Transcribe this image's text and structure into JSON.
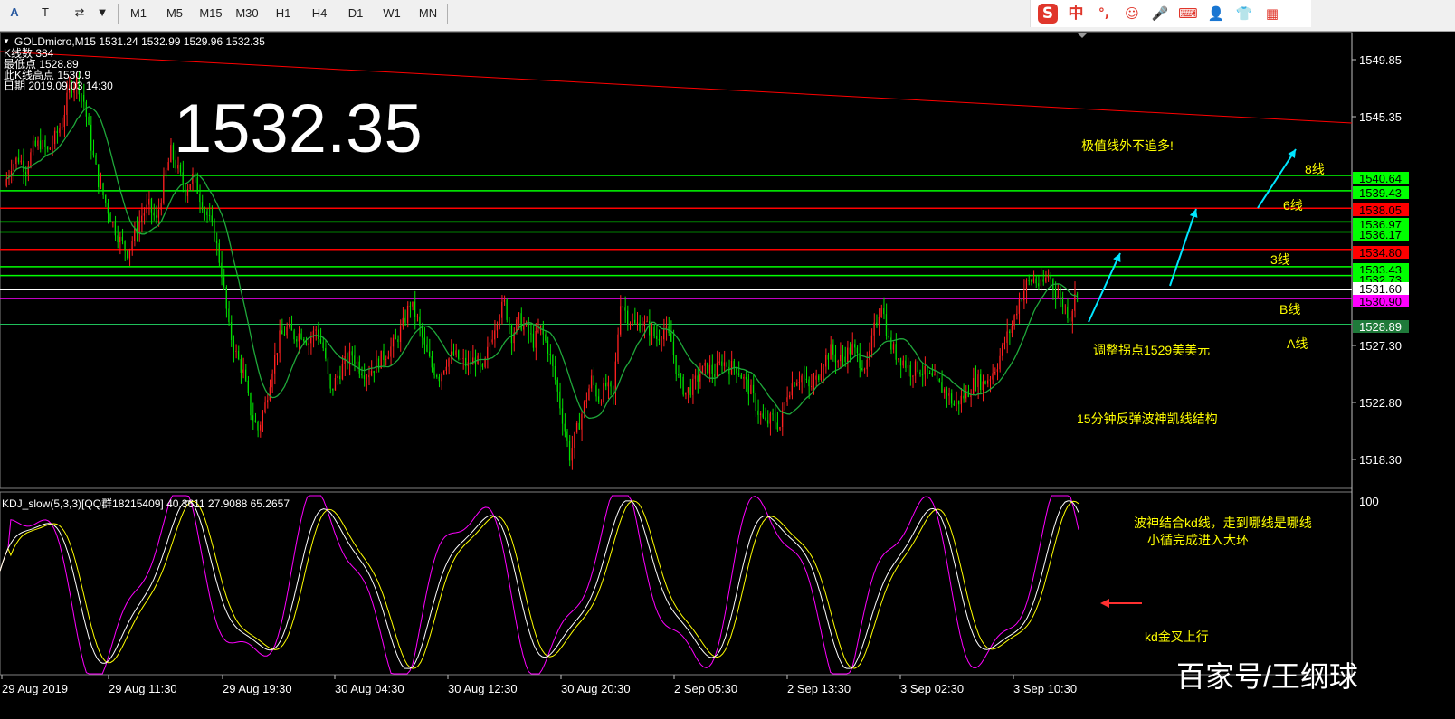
{
  "toolbar": {
    "left_tools": [
      {
        "name": "text-tool",
        "label": "A"
      },
      {
        "name": "text-label-tool",
        "label": "T"
      },
      {
        "name": "arrows-tool",
        "label": "⇄"
      },
      {
        "name": "dropdown",
        "label": "▼"
      }
    ],
    "timeframes": [
      "M1",
      "M5",
      "M15",
      "M30",
      "H1",
      "H4",
      "D1",
      "W1",
      "MN"
    ],
    "ime_bar": {
      "logo": "S",
      "mode": "中",
      "punct": "°,",
      "icons": [
        "emoji-icon",
        "microphone-icon",
        "keyboard-icon",
        "user-icon",
        "shirt-icon",
        "grid-icon"
      ]
    }
  },
  "main_chart": {
    "header": "GOLDmicro,M15  1531.24 1532.99 1529.96 1532.35",
    "info_lines": [
      "K线数  384",
      "最低点 1528.89",
      "此K线高点 1530.9",
      "日期 2019.09.03 14:30"
    ],
    "big_price": "1532.35",
    "annotations": [
      {
        "text": "极值线外不追多!",
        "color": "#ffff00"
      },
      {
        "text": "8线",
        "color": "#ffff00"
      },
      {
        "text": "6线",
        "color": "#ffff00"
      },
      {
        "text": "3线",
        "color": "#ffff00"
      },
      {
        "text": "B线",
        "color": "#ffff00"
      },
      {
        "text": "A线",
        "color": "#ffff00"
      },
      {
        "text": "调整拐点1529美美元",
        "color": "#ffff00"
      },
      {
        "text": "15分钟反弹波神凯线结构",
        "color": "#ffff00"
      }
    ],
    "price_axis": [
      "1549.85",
      "1545.35",
      "1527.30",
      "1522.80",
      "1518.30"
    ],
    "level_tags": [
      {
        "value": "1540.64",
        "bg": "#00ff00",
        "fg": "#000000"
      },
      {
        "value": "1539.43",
        "bg": "#00ff00",
        "fg": "#000000"
      },
      {
        "value": "1538.05",
        "bg": "#ff0000",
        "fg": "#000000"
      },
      {
        "value": "1536.97",
        "bg": "#00ff00",
        "fg": "#000000"
      },
      {
        "value": "1536.17",
        "bg": "#00ff00",
        "fg": "#000000"
      },
      {
        "value": "1534.80",
        "bg": "#ff0000",
        "fg": "#000000"
      },
      {
        "value": "1533.43",
        "bg": "#00ff00",
        "fg": "#000000"
      },
      {
        "value": "1532.73",
        "bg": "#00ff00",
        "fg": "#000000"
      },
      {
        "value": "1531.60",
        "bg": "#ffffff",
        "fg": "#000000"
      },
      {
        "value": "1530.90",
        "bg": "#ff00ff",
        "fg": "#000000"
      },
      {
        "value": "1528.89",
        "bg": "#1f7a3a",
        "fg": "#ffffff"
      }
    ]
  },
  "indicator": {
    "header": "KDJ_slow(5,3,3)[QQ群18215409] 40.3611 27.9088 65.2657",
    "axis_top": "100",
    "annotations": [
      {
        "text": "波神结合kd线，走到哪线是哪线"
      },
      {
        "text": "小循完成进入大环"
      },
      {
        "text": "kd金叉上行"
      }
    ]
  },
  "time_axis": [
    "29 Aug 2019",
    "29 Aug 11:30",
    "29 Aug 19:30",
    "30 Aug 04:30",
    "30 Aug 12:30",
    "30 Aug 20:30",
    "2 Sep 05:30",
    "2 Sep 13:30",
    "3 Sep 02:30",
    "3 Sep 10:30"
  ],
  "watermark": "百家号/王纲球",
  "chart_data": {
    "type": "candlestick",
    "symbol": "GOLDmicro",
    "timeframe": "M15",
    "ylim": [
      1516.5,
      1551.5
    ],
    "close_path": [
      1539.8,
      1541.5,
      1542.0,
      1541.2,
      1542.8,
      1543.2,
      1542.5,
      1543.6,
      1544.8,
      1547.5,
      1548.2,
      1546.5,
      1543.0,
      1540.2,
      1538.5,
      1536.8,
      1535.5,
      1534.6,
      1536.0,
      1537.5,
      1538.2,
      1537.0,
      1540.0,
      1542.5,
      1541.0,
      1539.5,
      1540.5,
      1539.0,
      1537.5,
      1536.0,
      1533.0,
      1528.5,
      1526.5,
      1525.0,
      1522.0,
      1520.5,
      1522.5,
      1525.5,
      1527.8,
      1528.5,
      1528.0,
      1528.2,
      1527.5,
      1528.5,
      1527.0,
      1523.5,
      1524.8,
      1525.8,
      1526.5,
      1525.5,
      1525.0,
      1525.5,
      1526.2,
      1526.8,
      1527.5,
      1528.8,
      1530.6,
      1529.2,
      1527.0,
      1525.5,
      1524.8,
      1526.0,
      1526.5,
      1526.0,
      1525.6,
      1526.2,
      1525.0,
      1527.5,
      1529.5,
      1530.5,
      1528.0,
      1529.2,
      1528.5,
      1527.5,
      1528.5,
      1527.0,
      1524.5,
      1521.5,
      1518.5,
      1520.5,
      1522.5,
      1524.5,
      1523.0,
      1524.0,
      1523.2,
      1530.8,
      1529.5,
      1528.8,
      1529.0,
      1528.5,
      1527.8,
      1528.5,
      1527.5,
      1524.5,
      1523.5,
      1524.0,
      1525.0,
      1525.5,
      1525.0,
      1526.0,
      1525.5,
      1525.5,
      1524.5,
      1523.5,
      1522.0,
      1521.0,
      1521.5,
      1520.8,
      1523.5,
      1524.5,
      1524.8,
      1523.8,
      1524.5,
      1526.0,
      1526.8,
      1526.0,
      1526.5,
      1527.0,
      1526.0,
      1525.5,
      1528.5,
      1530.6,
      1527.5,
      1526.5,
      1526.0,
      1525.2,
      1525.5,
      1525.0,
      1524.5,
      1524.0,
      1523.5,
      1522.5,
      1523.0,
      1523.6,
      1524.5,
      1524.2,
      1524.8,
      1525.8,
      1527.5,
      1528.8,
      1530.8,
      1532.0,
      1532.5,
      1531.8,
      1532.8,
      1531.5,
      1530.5,
      1529.5,
      1531.8
    ]
  }
}
